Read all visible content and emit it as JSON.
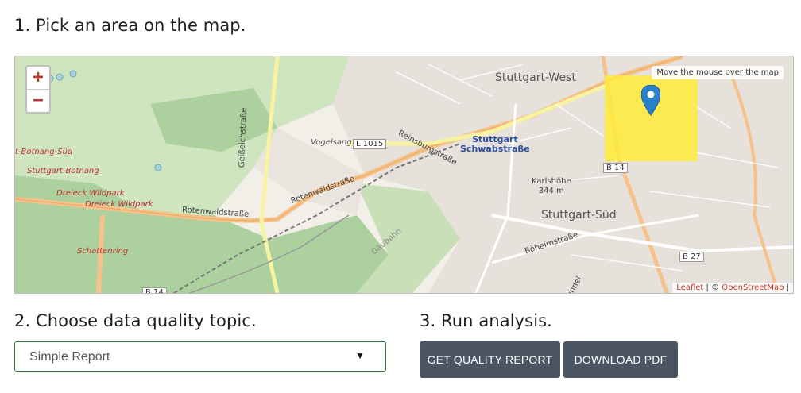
{
  "steps": {
    "step1": "1. Pick an area on the map.",
    "step2": "2. Choose data quality topic.",
    "step3": "3. Run analysis."
  },
  "map": {
    "zoom_in": "+",
    "zoom_out": "−",
    "hint": "Move the mouse over the map",
    "attribution_leaflet": "Leaflet",
    "attribution_sep": " | © ",
    "attribution_osm": "OpenStreetMap",
    "attribution_end": " |",
    "labels": {
      "stuttgart_west": "Stuttgart-West",
      "stuttgart_sued": "Stuttgart-Süd",
      "station": "Stuttgart",
      "station2": "Schwabstraße",
      "botnang_sued": "t-Botnang-Süd",
      "botnang": "Stuttgart-Botnang",
      "dreieck1": "Dreieck Wildpark",
      "dreieck2": "Dreieck Wildpark",
      "schattenring": "Schattenring",
      "rotenwald1": "Rotenwaldstraße",
      "rotenwald2": "Rotenwaldstraße",
      "reinsburg": "Reinsburgstraße",
      "vogelsang": "Vogelsang",
      "l1015": "L 1015",
      "karlshohe": "Karlshöhe",
      "karlshohe_elev": "344 m",
      "b14a": "B 14",
      "b14b": "B 14",
      "b27": "B 27",
      "boheim": "Böheimstraße",
      "gaubahn": "Gäubahn",
      "geissecht": "Geißeichstraße",
      "tunnel": "unnel"
    },
    "marker_color": "#2a81cb",
    "selection_color": "#ffeb3b"
  },
  "topic_select": {
    "selected": "Simple Report",
    "arrow": "▼"
  },
  "buttons": {
    "quality_report": "GET QUALITY REPORT",
    "download_pdf": "DOWNLOAD PDF"
  }
}
